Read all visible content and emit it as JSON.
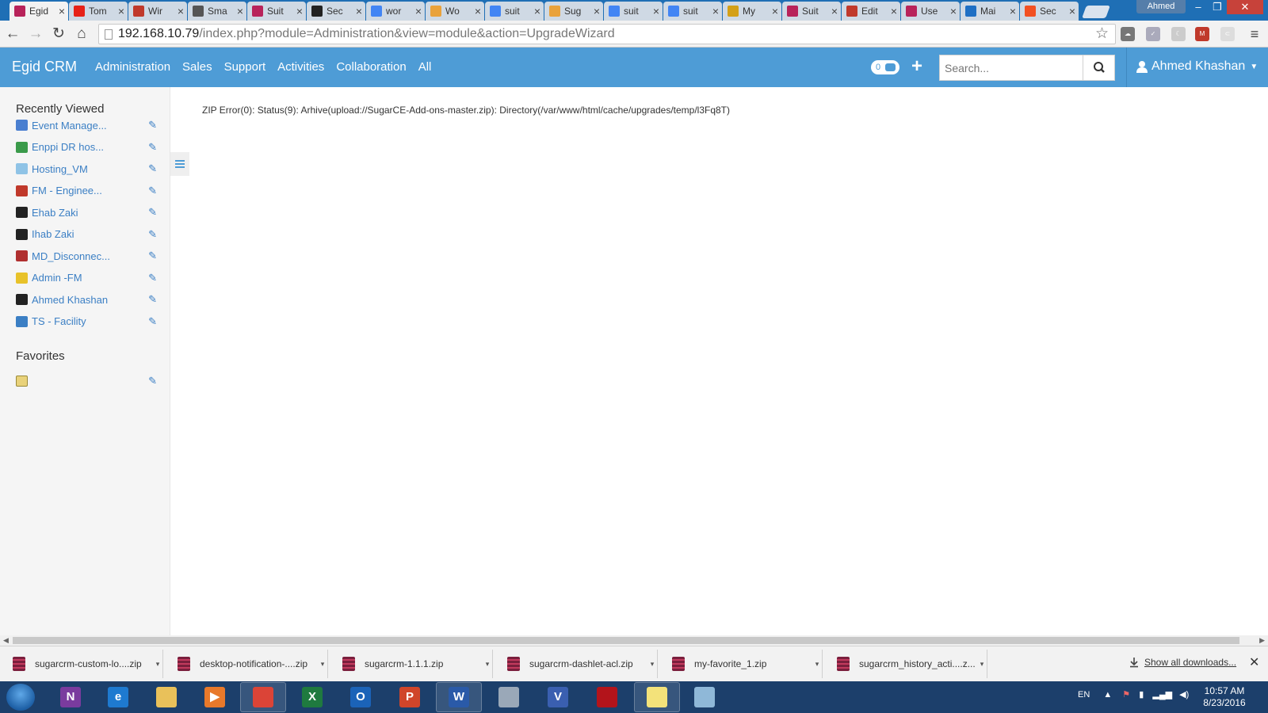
{
  "browser": {
    "tabs": [
      {
        "label": "Egid",
        "icon": "suitecrm-icon",
        "color": "#b8235a"
      },
      {
        "label": "Tom",
        "icon": "youtube-icon",
        "color": "#e62117"
      },
      {
        "label": "Wir",
        "icon": "wire-icon",
        "color": "#c0392b"
      },
      {
        "label": "Sma",
        "icon": "smart-icon",
        "color": "#555555"
      },
      {
        "label": "Suit",
        "icon": "suitecrm-icon",
        "color": "#b8235a"
      },
      {
        "label": "Sec",
        "icon": "so-icon",
        "color": "#222222"
      },
      {
        "label": "wor",
        "icon": "google-icon",
        "color": "#4285f4"
      },
      {
        "label": "Wo",
        "icon": "sugar-icon",
        "color": "#e9a23b"
      },
      {
        "label": "suit",
        "icon": "google-icon",
        "color": "#4285f4"
      },
      {
        "label": "Sug",
        "icon": "sugar-icon",
        "color": "#e9a23b"
      },
      {
        "label": "suit",
        "icon": "google-icon",
        "color": "#4285f4"
      },
      {
        "label": "suit",
        "icon": "google-icon",
        "color": "#4285f4"
      },
      {
        "label": "My",
        "icon": "crown-icon",
        "color": "#d4a017"
      },
      {
        "label": "Suit",
        "icon": "suitecrm-icon",
        "color": "#b8235a"
      },
      {
        "label": "Edit",
        "icon": "edit-icon",
        "color": "#c0392b"
      },
      {
        "label": "Use",
        "icon": "suitecrm-icon",
        "color": "#b8235a"
      },
      {
        "label": "Mai",
        "icon": "mail-icon",
        "color": "#1e6fc4"
      },
      {
        "label": "Sec",
        "icon": "microsoft-icon",
        "color": "#f25022"
      }
    ],
    "profile_name": "Ahmed",
    "url_host": "192.168.10.79",
    "url_path": "/index.php?module=Administration&view=module&action=UpgradeWizard"
  },
  "crm": {
    "brand": "Egid CRM",
    "menu": [
      "Administration",
      "Sales",
      "Support",
      "Activities",
      "Collaboration",
      "All"
    ],
    "notifications_count": "0",
    "search_placeholder": "Search...",
    "user_name": "Ahmed Khashan"
  },
  "sidebar": {
    "recently_viewed_title": "Recently Viewed",
    "recent": [
      {
        "label": "Event Manage...",
        "icon": "arrows-icon",
        "color": "#4a7fd0"
      },
      {
        "label": "Enppi DR hos...",
        "icon": "money-icon",
        "color": "#3a9a4a"
      },
      {
        "label": "Hosting_VM",
        "icon": "screen-icon",
        "color": "#8fc3e6"
      },
      {
        "label": "FM - Enginee...",
        "icon": "chart-icon",
        "color": "#c0392b"
      },
      {
        "label": "Ehab Zaki",
        "icon": "contacts-icon",
        "color": "#222222"
      },
      {
        "label": "Ihab Zaki",
        "icon": "contacts-icon",
        "color": "#222222"
      },
      {
        "label": "MD_Disconnec...",
        "icon": "shield-icon",
        "color": "#b03030"
      },
      {
        "label": "Admin -FM",
        "icon": "bell-icon",
        "color": "#e8c22a"
      },
      {
        "label": "Ahmed Khashan",
        "icon": "contacts-icon",
        "color": "#222222"
      },
      {
        "label": "TS - Facility",
        "icon": "calendar-icon",
        "color": "#3b7fc4"
      }
    ],
    "favorites_title": "Favorites"
  },
  "main": {
    "error_message": "ZIP Error(0): Status(9): Arhive(upload://SugarCE-Add-ons-master.zip): Directory(/var/www/html/cache/upgrades/temp/l3Fq8T)"
  },
  "downloads": {
    "items": [
      "sugarcrm-custom-lo....zip",
      "desktop-notification-....zip",
      "sugarcrm-1.1.1.zip",
      "sugarcrm-dashlet-acl.zip",
      "my-favorite_1.zip",
      "sugarcrm_history_acti....z..."
    ],
    "show_all": "Show all downloads..."
  },
  "taskbar": {
    "apps": [
      {
        "name": "onenote-icon",
        "letter": "N",
        "color": "#7a3b9e"
      },
      {
        "name": "ie-icon",
        "letter": "e",
        "color": "#1e7ad0"
      },
      {
        "name": "explorer-icon",
        "letter": "",
        "color": "#e9c15a"
      },
      {
        "name": "media-player-icon",
        "letter": "▶",
        "color": "#e8792b"
      },
      {
        "name": "chrome-icon",
        "letter": "",
        "color": "#db4437"
      },
      {
        "name": "excel-icon",
        "letter": "X",
        "color": "#1f7a3f"
      },
      {
        "name": "outlook-icon",
        "letter": "O",
        "color": "#1b63b8"
      },
      {
        "name": "powerpoint-icon",
        "letter": "P",
        "color": "#d0452a"
      },
      {
        "name": "word-icon",
        "letter": "W",
        "color": "#2a5aa8"
      },
      {
        "name": "calculator-icon",
        "letter": "",
        "color": "#9aa8b8"
      },
      {
        "name": "visio-icon",
        "letter": "V",
        "color": "#3a5fb0"
      },
      {
        "name": "acrobat-icon",
        "letter": "",
        "color": "#b3141b"
      },
      {
        "name": "sticky-notes-icon",
        "letter": "",
        "color": "#f3e27a"
      },
      {
        "name": "paint-icon",
        "letter": "",
        "color": "#8fb8d8"
      }
    ],
    "language": "EN",
    "time": "10:57 AM",
    "date": "8/23/2016"
  }
}
